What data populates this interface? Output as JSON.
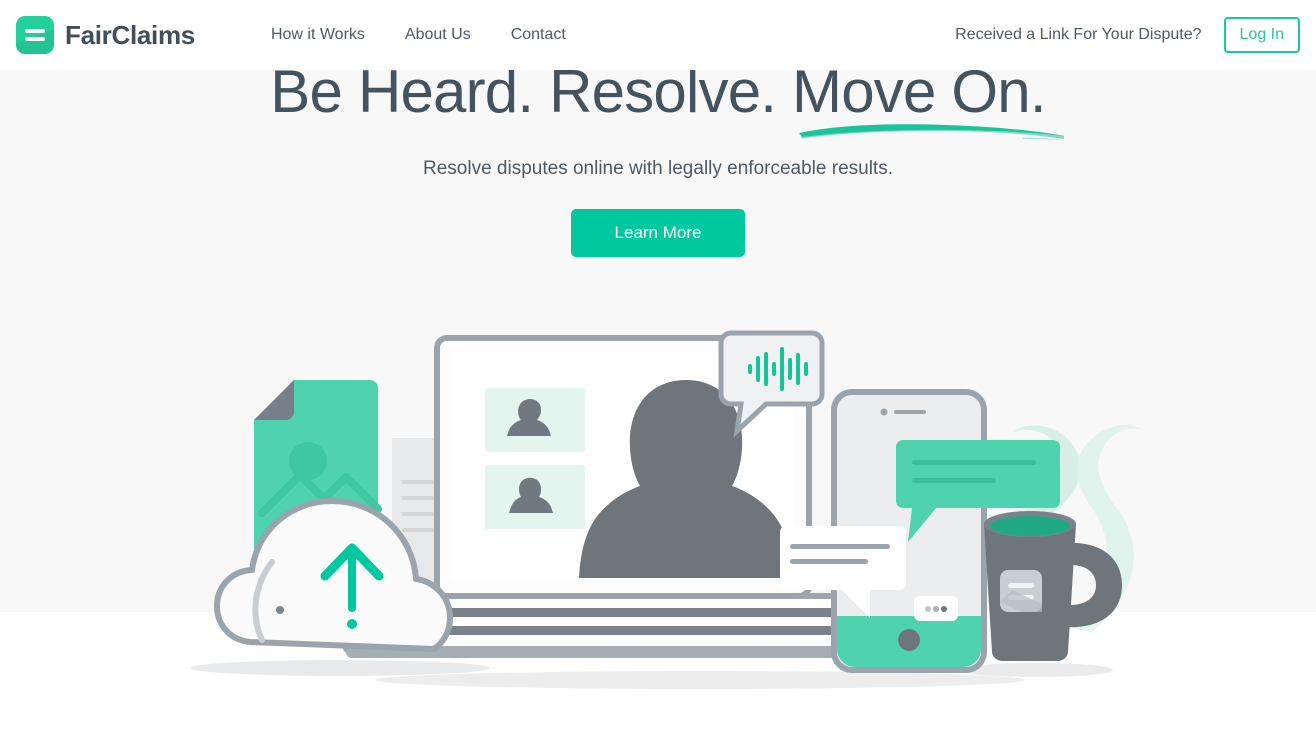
{
  "header": {
    "brand": {
      "name": "FairClaims",
      "logo_icon": "equals-bars-icon",
      "accent": "#24D09A"
    },
    "nav": [
      {
        "label": "How it Works",
        "name": "how-it-works"
      },
      {
        "label": "About Us",
        "name": "about-us"
      },
      {
        "label": "Contact",
        "name": "contact"
      }
    ],
    "received_link": "Received a Link For Your Dispute?",
    "login_label": "Log In",
    "login_border_color": "#19C89C",
    "login_text_color": "#2FC49A"
  },
  "hero": {
    "headline_part1": "Be Heard. Resolve. ",
    "headline_part2": "Move On.",
    "headline_color": "#43535F",
    "underline_color": "#1CC49C",
    "subhead": "Resolve disputes online with legally enforceable results.",
    "cta_label": "Learn More",
    "cta_color": "#00C9A0",
    "background": "#F8F8F8"
  },
  "illustration": {
    "name": "online-dispute-resolution-illustration",
    "alt": "Laptop video call with participants, documents uploading to cloud, smartphone chat and coffee mug",
    "parts": [
      {
        "name": "photo-document-green",
        "color": "#4FD2AE"
      },
      {
        "name": "paper-document-stack",
        "color": "#E4E6E8"
      },
      {
        "name": "upload-cloud",
        "color": "#FFFFFF"
      },
      {
        "name": "upload-arrow",
        "color": "#00C9A0"
      },
      {
        "name": "laptop",
        "color": "#9AA4AC"
      },
      {
        "name": "video-call-participant-large",
        "color": "#6E767C"
      },
      {
        "name": "video-call-thumbnail-1",
        "color": "#E4F4EE"
      },
      {
        "name": "video-call-thumbnail-2",
        "color": "#E4F4EE"
      },
      {
        "name": "audio-speech-bubble",
        "color": "#EDEFF0"
      },
      {
        "name": "audio-waveform",
        "color": "#16C49A"
      },
      {
        "name": "smartphone",
        "color": "#9AA4AC"
      },
      {
        "name": "chat-bubble-outgoing",
        "color": "#4FD2AE"
      },
      {
        "name": "chat-bubble-incoming",
        "color": "#FFFFFF"
      },
      {
        "name": "typing-dots",
        "color": "#8C959C"
      },
      {
        "name": "coffee-mug",
        "color": "#6E767C"
      },
      {
        "name": "mug-logo",
        "color": "#C9CED2"
      },
      {
        "name": "steam",
        "color": "#CFEEE2"
      }
    ]
  }
}
